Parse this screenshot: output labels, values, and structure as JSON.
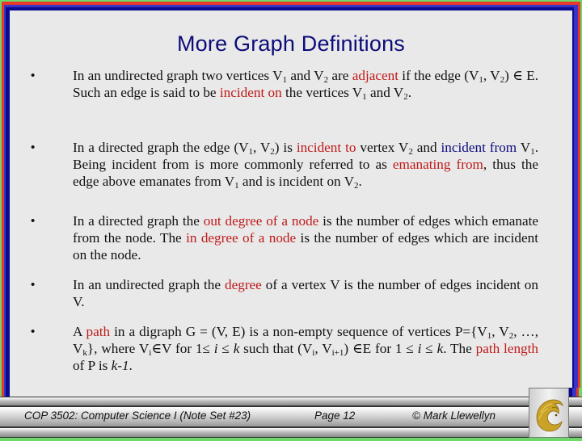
{
  "slide": {
    "title": "More Graph Definitions",
    "bullets": [
      {
        "parts": [
          "In an undirected graph two vertices V",
          "1",
          " and V",
          "2",
          " are ",
          "adjacent",
          " if the edge (V",
          "1",
          ", V",
          "2",
          ") ∈ E.  Such an edge is said to be ",
          "incident on",
          " the vertices V",
          "1",
          " and V",
          "2",
          "."
        ]
      },
      {
        "parts": [
          "In a directed graph the edge (V",
          "1",
          ", V",
          "2",
          ")  is ",
          "incident to",
          " vertex V",
          "2",
          " and ",
          "incident from",
          " V",
          "1",
          ".  Being incident from is more commonly referred to as ",
          "emanating from",
          ", thus the edge above emanates from V",
          "1",
          " and is incident on V",
          "2",
          "."
        ]
      },
      {
        "parts": [
          "In a directed graph the ",
          "out degree of a node",
          " is the number of edges which emanate from the node.  The ",
          "in degree of a node",
          " is the number of edges which are incident on the node."
        ]
      },
      {
        "parts": [
          "In an undirected graph the ",
          "degree",
          " of a vertex V is the number of edges incident on V."
        ]
      },
      {
        "parts": [
          "A ",
          "path",
          " in a digraph G = (V, E) is a non-empty sequence of vertices P={V",
          "1",
          ", V",
          "2",
          ", …, V",
          "k",
          "}, where V",
          "i",
          "∈V for 1≤ ",
          "i",
          " ≤ ",
          "k",
          " such that (V",
          "i",
          ", V",
          "i+1",
          ") ∈E for 1 ≤ ",
          "i",
          " ≤ ",
          "k",
          ".  The ",
          "path length",
          " of P is ",
          "k-1",
          "."
        ]
      }
    ],
    "bullet_glyph": "•"
  },
  "footer": {
    "course": "COP 3502: Computer Science I  (Note Set #23)",
    "page": "Page 12",
    "copyright": "© Mark Llewellyn",
    "logo_icon": "ucf-pegasus-logo"
  },
  "colors": {
    "title": "#0c0c7a",
    "highlight_red": "#c01a1a",
    "highlight_navy": "#0c0c80",
    "background": "#e9e9e9",
    "logo_gold": "#c9a227"
  }
}
